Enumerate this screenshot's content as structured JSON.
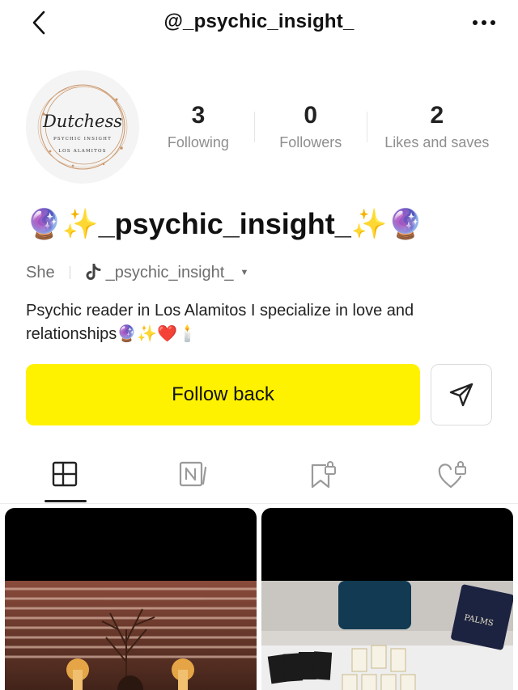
{
  "header": {
    "handle": "@_psychic_insight_",
    "back_icon": "chevron-left-icon",
    "more_icon": "more-horizontal-icon"
  },
  "avatar": {
    "logo_text": "Dutchess",
    "logo_sub1": "PSYCHIC INSIGHT",
    "logo_sub2": "LOS ALAMITOS"
  },
  "stats": [
    {
      "value": "3",
      "label": "Following"
    },
    {
      "value": "0",
      "label": "Followers"
    },
    {
      "value": "2",
      "label": "Likes and saves"
    }
  ],
  "profile": {
    "display_name": "🔮✨_psychic_insight_✨🔮",
    "pronoun": "She",
    "linked_account": "_psychic_insight_",
    "bio": "Psychic reader in Los Alamitos I specialize in love and relationships🔮✨❤️🕯️"
  },
  "actions": {
    "follow_label": "Follow back",
    "message_icon": "send-icon"
  },
  "tabs": [
    {
      "name": "posts",
      "icon": "grid-layout-icon",
      "active": true
    },
    {
      "name": "notes",
      "icon": "notes-icon",
      "active": false
    },
    {
      "name": "saved",
      "icon": "bookmark-lock-icon",
      "active": false
    },
    {
      "name": "liked",
      "icon": "heart-lock-icon",
      "active": false
    }
  ],
  "colors": {
    "accent_yellow": "#fff200",
    "muted_text": "#8e8e8e"
  }
}
